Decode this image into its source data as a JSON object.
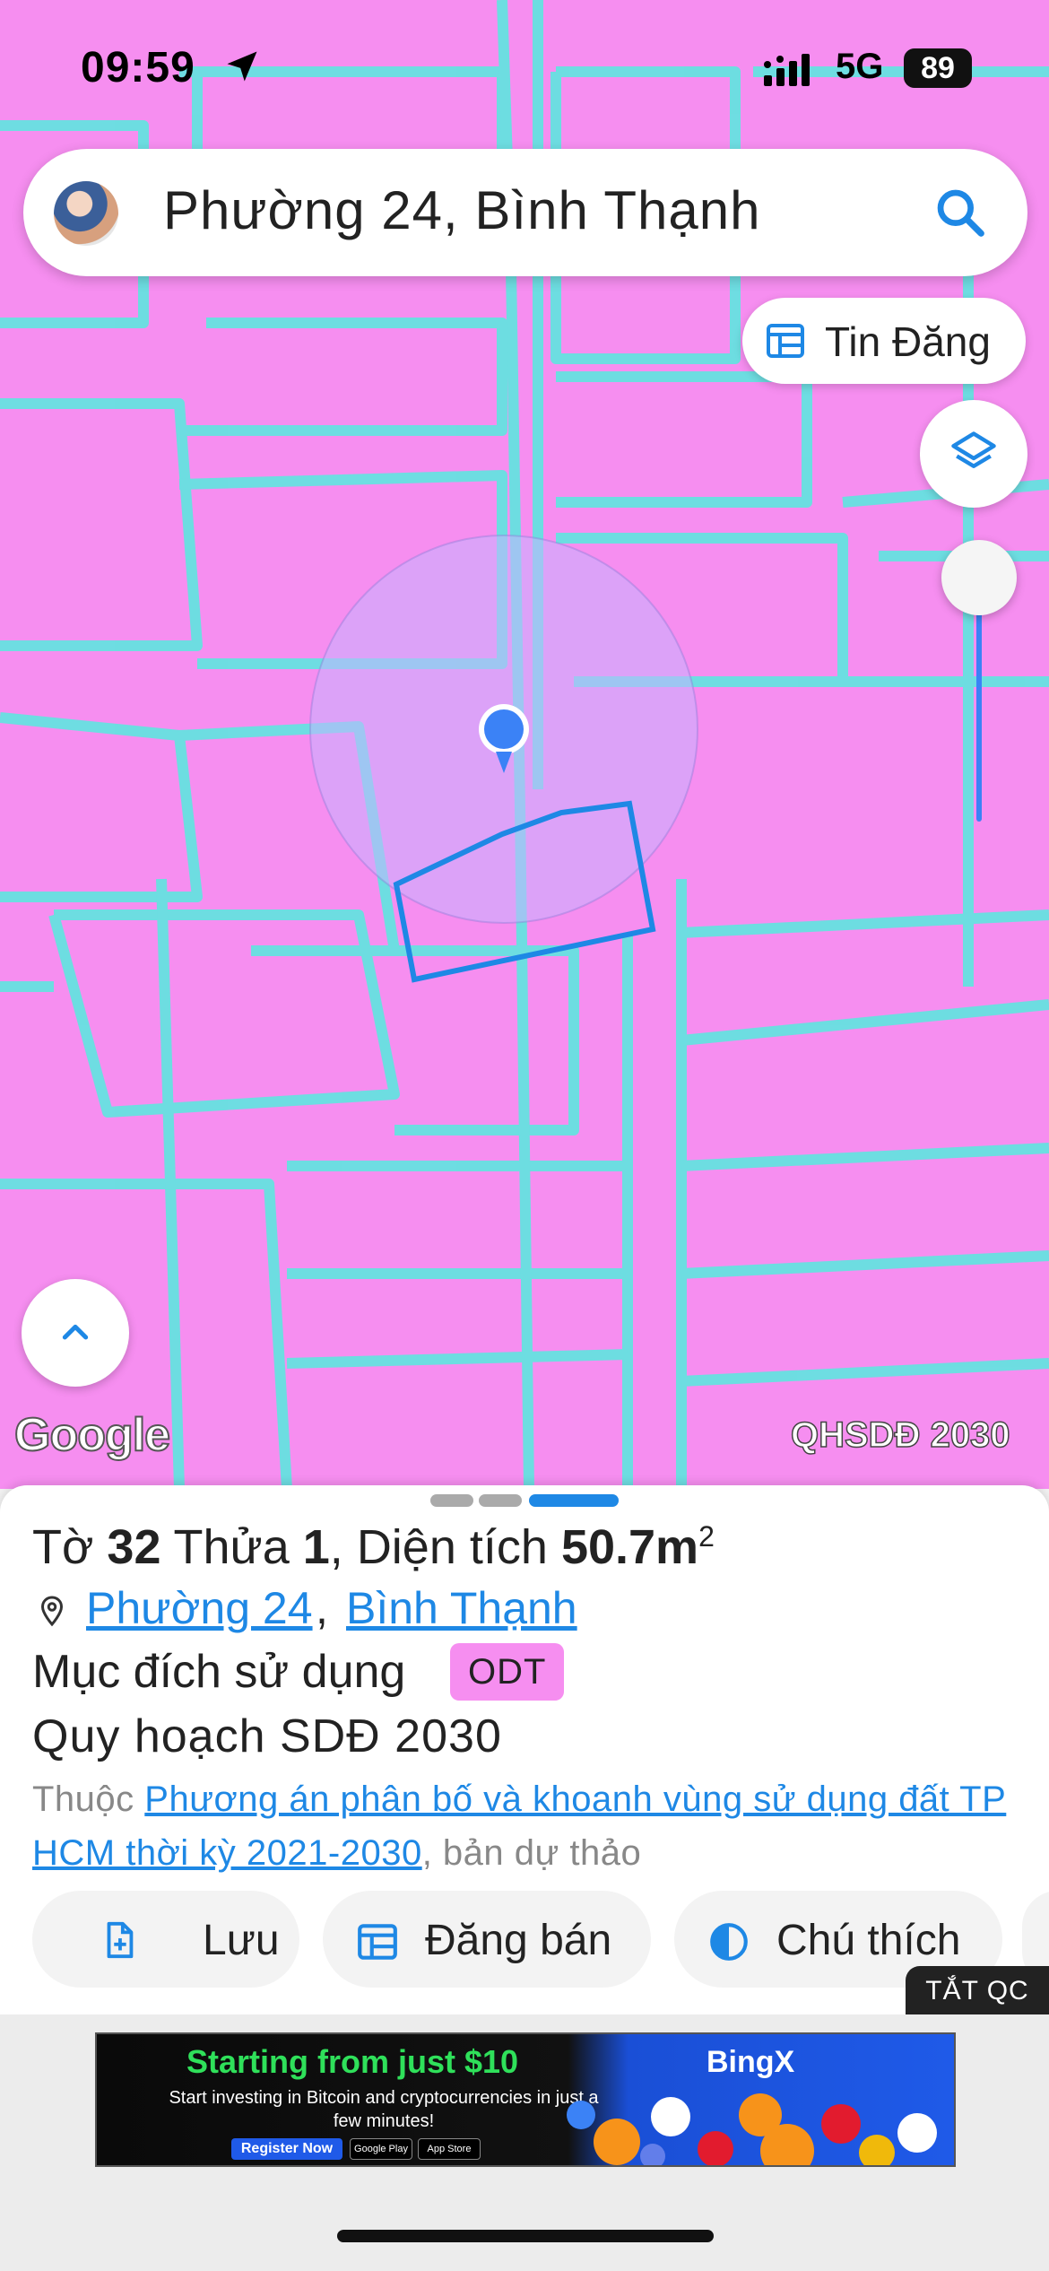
{
  "status_bar": {
    "time": "09:59",
    "network": "5G",
    "battery": "89"
  },
  "search": {
    "query": "Phường 24, Bình Thạnh"
  },
  "map_controls": {
    "post_button_label": "Tin Đăng",
    "google_attribution": "Google",
    "layer_tag": "QHSDĐ 2030"
  },
  "parcel": {
    "sheet_label": "Tờ",
    "sheet_number": "32",
    "plot_label": "Thửa",
    "plot_number": "1",
    "area_label": "Diện tích",
    "area_value": "50.7m",
    "area_unit_sup": "2",
    "ward_link": "Phường 24",
    "district_link": "Bình Thạnh",
    "purpose_label": "Mục đích sử dụng",
    "purpose_code": "ODT",
    "plan_label": "Quy hoạch SDĐ 2030",
    "belongs_prefix": "Thuộc",
    "belongs_link": "Phương án phân bố và khoanh vùng sử dụng đất TP HCM thời kỳ 2021-2030",
    "belongs_suffix": ", bản dự thảo"
  },
  "actions": {
    "save_label": "Lưu",
    "post_sale_label": "Đăng bán",
    "legend_label": "Chú thích"
  },
  "ad": {
    "close_label": "TẮT QC",
    "headline": "Starting from just $10",
    "subtext": "Start investing in Bitcoin and cryptocurrencies in just a few minutes!",
    "cta": "Register Now",
    "store_google": "Google Play",
    "store_apple": "App Store",
    "brand": "BingX"
  },
  "colors": {
    "map_fill": "#f68ef0",
    "parcel_border": "#5fe6e0",
    "accent_blue": "#1e88e5",
    "odt_badge": "#f68ef0"
  },
  "icons": {
    "location_arrow": "location-arrow-icon",
    "search": "search-icon",
    "post": "calendar-table-icon",
    "layers": "layers-icon",
    "expand": "chevron-up-icon",
    "pin": "map-pin-icon",
    "save": "add-file-icon",
    "post_sale": "calendar-table-icon",
    "legend": "contrast-icon"
  }
}
